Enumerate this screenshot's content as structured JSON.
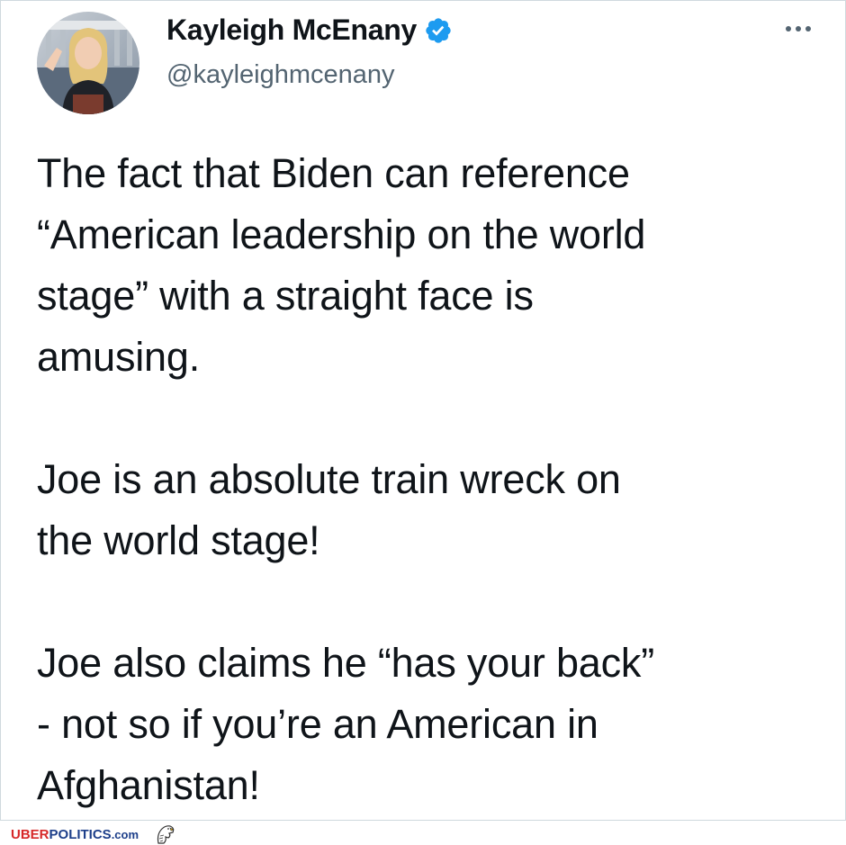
{
  "tweet": {
    "display_name": "Kayleigh McEnany",
    "handle": "@kayleighmcenany",
    "verified_icon": "verified-badge-icon",
    "more_icon": "more-horizontal-icon",
    "avatar_icon": "profile-photo",
    "paragraphs": [
      "The fact that Biden can reference\n“American leadership on the world\nstage” with a straight face is\namusing.",
      "Joe is an absolute train wreck on\nthe world stage!",
      "Joe also claims he “has your back”\n- not so if you’re an American in\nAfghanistan!"
    ]
  },
  "watermark": {
    "part1": "UBER",
    "part2": "POLITICS",
    "part3": ".com",
    "icon": "eagle-icon"
  },
  "colors": {
    "verified": "#1d9bf0",
    "handle": "#536471",
    "text": "#0f1419",
    "watermark_red": "#d62828",
    "watermark_blue": "#1d3f8a"
  }
}
